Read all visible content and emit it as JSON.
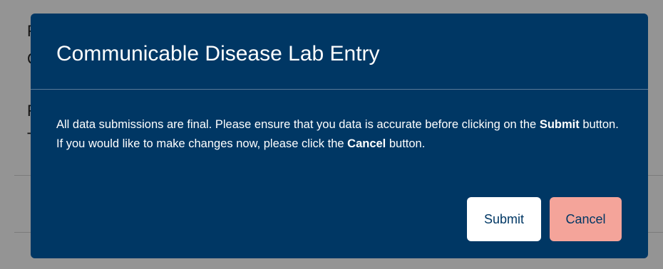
{
  "background": {
    "glyphs": [
      "F",
      "C",
      "F",
      "T"
    ]
  },
  "modal": {
    "title": "Communicable Disease Lab Entry",
    "message": {
      "part1": "All data submissions are final. Please ensure that you data is accurate before clicking on the ",
      "bold1": "Submit",
      "part2": " button. If you would like to make changes now, please click the ",
      "bold2": "Cancel",
      "part3": " button."
    },
    "buttons": {
      "submit_label": "Submit",
      "cancel_label": "Cancel"
    }
  },
  "colors": {
    "modal_bg": "#003764",
    "submit_bg": "#ffffff",
    "cancel_bg": "#f4a49a",
    "overlay": "rgba(0,0,0,0.42)"
  }
}
